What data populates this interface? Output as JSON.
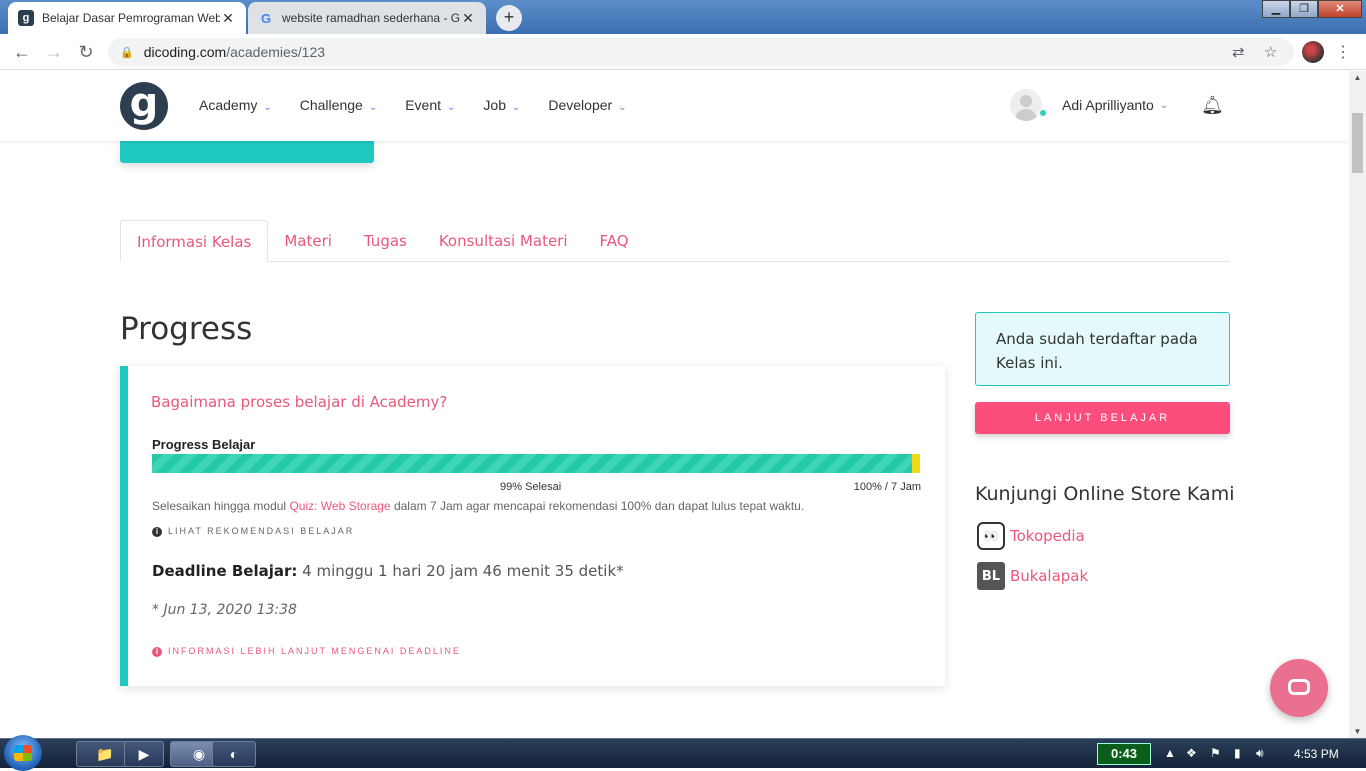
{
  "browser": {
    "tabs": [
      {
        "title": "Belajar Dasar Pemrograman Web",
        "favicon": "dicoding-icon",
        "active": true
      },
      {
        "title": "website ramadhan sederhana - G",
        "favicon": "google-icon",
        "active": false
      }
    ],
    "url_domain": "dicoding.com",
    "url_path": "/academies/123",
    "window_controls": {
      "minimize": "▁",
      "maximize": "❐",
      "close": "✕"
    }
  },
  "site_nav": {
    "logo_text": "g",
    "items": [
      {
        "label": "Academy"
      },
      {
        "label": "Challenge"
      },
      {
        "label": "Event"
      },
      {
        "label": "Job"
      },
      {
        "label": "Developer"
      }
    ],
    "user_name": "Adi Aprilliyanto"
  },
  "page_tabs": [
    {
      "label": "Informasi Kelas",
      "active": true
    },
    {
      "label": "Materi",
      "active": false
    },
    {
      "label": "Tugas",
      "active": false
    },
    {
      "label": "Konsultasi Materi",
      "active": false
    },
    {
      "label": "FAQ",
      "active": false
    }
  ],
  "progress": {
    "heading": "Progress",
    "question_link": "Bagaimana proses belajar di Academy?",
    "bar_label": "Progress Belajar",
    "percent_done": 99,
    "done_label": "99% Selesai",
    "target_label": "100% / 7 Jam",
    "desc_before": "Selesaikan hingga modul ",
    "desc_link": "Quiz: Web Storage",
    "desc_after": " dalam 7 Jam agar mencapai rekomendasi 100% dan dapat lulus tepat waktu.",
    "recommend_link": "LIHAT REKOMENDASI BELAJAR",
    "deadline_label": "Deadline Belajar:",
    "deadline_value": " 4 minggu 1 hari 20 jam 46 menit 35 detik*",
    "deadline_date": "* Jun 13, 2020 13:38",
    "more_info_link": "INFORMASI LEBIH LANJUT MENGENAI DEADLINE"
  },
  "sidebar": {
    "notice": "Anda sudah terdaftar pada Kelas ini.",
    "cta": "LANJUT BELAJAR",
    "store_heading": "Kunjungi Online Store Kami",
    "stores": [
      {
        "label": "Tokopedia",
        "icon_text": "👀"
      },
      {
        "label": "Bukalapak",
        "icon_text": "BL"
      }
    ]
  },
  "taskbar": {
    "timer": "0:43",
    "clock": "4:53 PM"
  },
  "colors": {
    "accent_pink": "#e9587a",
    "teal": "#1ec9c0",
    "cta_pink": "#fd4d7c",
    "nav_dark": "#2d3e50"
  }
}
